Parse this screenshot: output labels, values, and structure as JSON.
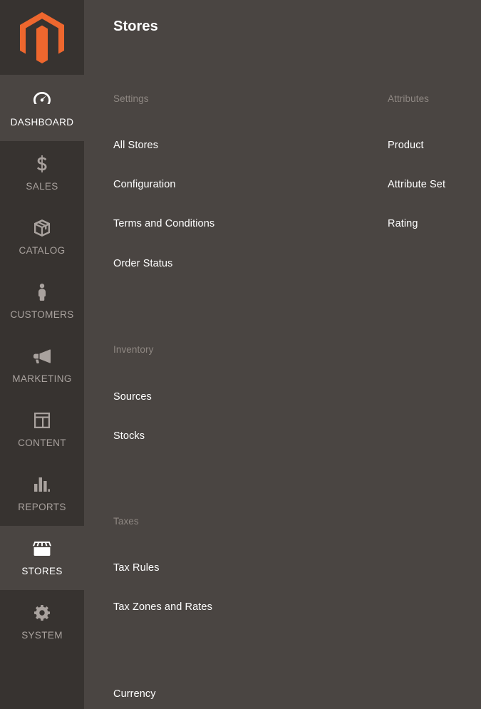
{
  "app": {
    "name": "Magento Admin",
    "logo_icon": "magento-logo-icon",
    "brand_color": "#ee672e",
    "sidebar_bg": "#373330",
    "panel_bg": "#4a4542",
    "active_bg": "#4a4542",
    "muted_text": "#8e8782",
    "label_text": "#a9a29e"
  },
  "sidebar": {
    "items": [
      {
        "label": "DASHBOARD",
        "icon": "dashboard-gauge-icon",
        "active": true
      },
      {
        "label": "SALES",
        "icon": "dollar-sign-icon",
        "active": false
      },
      {
        "label": "CATALOG",
        "icon": "box-package-icon",
        "active": false
      },
      {
        "label": "CUSTOMERS",
        "icon": "person-icon",
        "active": false
      },
      {
        "label": "MARKETING",
        "icon": "megaphone-icon",
        "active": false
      },
      {
        "label": "CONTENT",
        "icon": "layout-grid-icon",
        "active": false
      },
      {
        "label": "REPORTS",
        "icon": "bar-chart-icon",
        "active": false
      },
      {
        "label": "STORES",
        "icon": "storefront-awning-icon",
        "active": true
      },
      {
        "label": "SYSTEM",
        "icon": "gear-icon",
        "active": false
      }
    ]
  },
  "header": {
    "title": "Stores"
  },
  "menu": {
    "left_column": [
      {
        "title": "Settings",
        "items": [
          {
            "label": "All Stores"
          },
          {
            "label": "Configuration"
          },
          {
            "label": "Terms and Conditions"
          },
          {
            "label": "Order Status"
          }
        ]
      },
      {
        "title": "Inventory",
        "items": [
          {
            "label": "Sources"
          },
          {
            "label": "Stocks"
          }
        ]
      },
      {
        "title": "Taxes",
        "items": [
          {
            "label": "Tax Rules"
          },
          {
            "label": "Tax Zones and Rates"
          }
        ]
      },
      {
        "title": "",
        "items": [
          {
            "label": "Currency"
          }
        ]
      }
    ],
    "right_column": [
      {
        "title": "Attributes",
        "items": [
          {
            "label": "Product"
          },
          {
            "label": "Attribute Set"
          },
          {
            "label": "Rating"
          }
        ]
      }
    ]
  }
}
